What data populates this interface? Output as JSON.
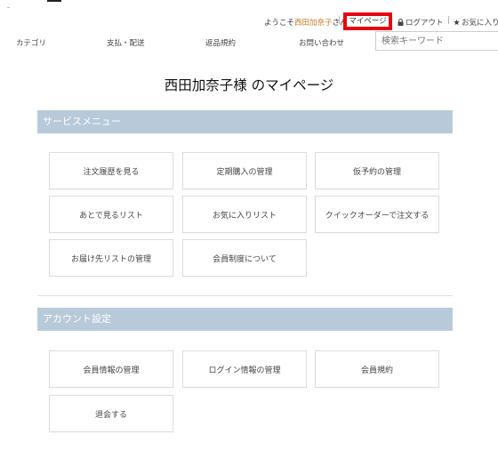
{
  "header": {
    "welcome_prefix": "ようこそ",
    "user_name": "西田加奈子",
    "welcome_suffix": "さん",
    "mypage_label": "マイページ",
    "logout_label": "ログアウト",
    "favorites_label": "お気に入り"
  },
  "nav": {
    "items": [
      "カテゴリ",
      "支払・配送",
      "返品規約",
      "お問い合わせ"
    ],
    "search_placeholder": "検索キーワード"
  },
  "page_title": "西田加奈子様 のマイページ",
  "service_menu": {
    "heading": "サービスメニュー",
    "items": [
      "注文履歴を見る",
      "定期購入の管理",
      "仮予約の管理",
      "あとで見るリスト",
      "お気に入りリスト",
      "クイックオーダーで注文する",
      "お届け先リストの管理",
      "会員制度について"
    ]
  },
  "account_settings": {
    "heading": "アカウント設定",
    "items": [
      "会員情報の管理",
      "ログイン情報の管理",
      "会員規約",
      "退会する"
    ]
  },
  "colors": {
    "section_header_bg": "#b8cad9",
    "highlight_border": "#e60012",
    "username_color": "#c07a2a"
  }
}
